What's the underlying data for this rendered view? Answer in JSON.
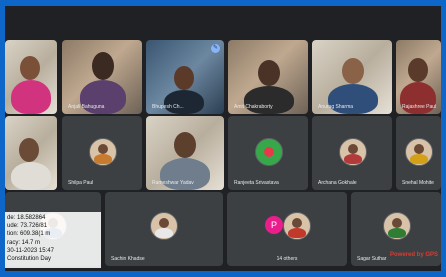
{
  "meeting": {
    "participants": [
      {
        "name": ""
      },
      {
        "name": "Anjali Bahuguna"
      },
      {
        "name": "Bhupesh Ch..."
      },
      {
        "name": "Amit Chakraborty"
      },
      {
        "name": "Anurag Sharma"
      },
      {
        "name": "Rajashree Paul"
      },
      {
        "name": ""
      },
      {
        "name": "Shilpa Paul"
      },
      {
        "name": "Rameshwar Yadav"
      },
      {
        "name": "Ranjeeta Srivastava"
      },
      {
        "name": "Archana Gokhale"
      },
      {
        "name": "Snehal Mohite"
      },
      {
        "name": ""
      },
      {
        "name": "Sachin Khadse"
      },
      {
        "name": "Sagar Suthar"
      }
    ],
    "others_tile": {
      "avatar_letter": "P",
      "label": "14 others"
    }
  },
  "gps_overlay": {
    "lines": [
      "de: 18.582864",
      "ude: 73.726/81",
      "tion: 609.38(1 m",
      "racy: 14.7 m",
      "30-11-2023 15:47",
      "Constitution Day"
    ]
  },
  "watermark": {
    "text": "Powered by GPS"
  },
  "colors": {
    "frame": "#0f66c9",
    "background": "#202124",
    "tile": "#3c4043",
    "accent": "#8ab4f8"
  }
}
